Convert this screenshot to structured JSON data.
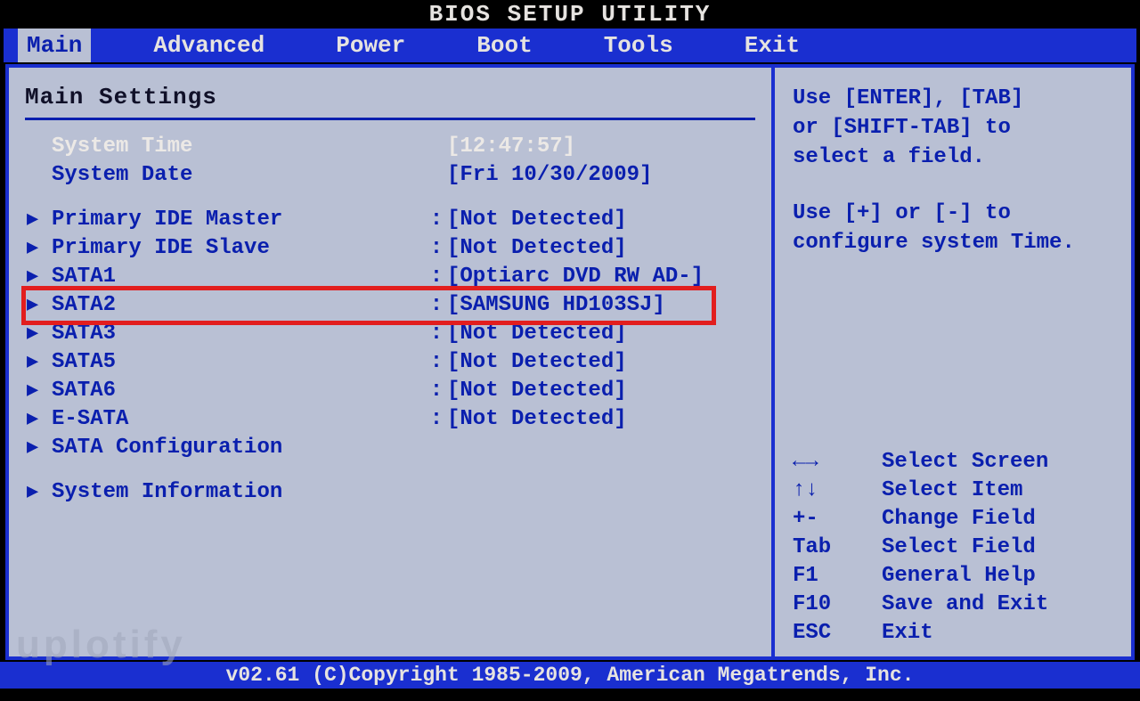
{
  "title": "BIOS SETUP UTILITY",
  "menu": {
    "items": [
      "Main",
      "Advanced",
      "Power",
      "Boot",
      "Tools",
      "Exit"
    ],
    "active_index": 0
  },
  "section_title": "Main Settings",
  "sys": {
    "time_label": "System Time",
    "time_value": "[12:47:57]",
    "date_label": "System Date",
    "date_value": "[Fri 10/30/2009]"
  },
  "devices": [
    {
      "label": "Primary IDE Master",
      "value": "[Not Detected]",
      "has_colon": true
    },
    {
      "label": "Primary IDE Slave",
      "value": "[Not Detected]",
      "has_colon": true
    },
    {
      "label": "SATA1",
      "value": "[Optiarc DVD RW AD-]",
      "has_colon": true
    },
    {
      "label": "SATA2",
      "value": "[SAMSUNG HD103SJ]",
      "has_colon": true
    },
    {
      "label": "SATA3",
      "value": "[Not Detected]",
      "has_colon": true
    },
    {
      "label": "SATA5",
      "value": "[Not Detected]",
      "has_colon": true
    },
    {
      "label": "SATA6",
      "value": "[Not Detected]",
      "has_colon": true
    },
    {
      "label": "E-SATA",
      "value": "[Not Detected]",
      "has_colon": true
    },
    {
      "label": "SATA Configuration",
      "value": "",
      "has_colon": false
    }
  ],
  "sysinfo_label": "System Information",
  "help": {
    "line1": "Use [ENTER], [TAB]",
    "line2": "or [SHIFT-TAB] to",
    "line3": "select a field.",
    "line4": "Use [+] or [-] to",
    "line5": "configure system Time."
  },
  "legend": [
    {
      "key": "←→",
      "desc": "Select Screen"
    },
    {
      "key": "↑↓",
      "desc": "Select Item"
    },
    {
      "key": "+-",
      "desc": "Change Field"
    },
    {
      "key": "Tab",
      "desc": "Select Field"
    },
    {
      "key": "F1",
      "desc": "General Help"
    },
    {
      "key": "F10",
      "desc": "Save and Exit"
    },
    {
      "key": "ESC",
      "desc": "Exit"
    }
  ],
  "footer": "v02.61 (C)Copyright 1985-2009, American Megatrends, Inc.",
  "watermark": "uplotify",
  "highlighted_device_index": 3
}
